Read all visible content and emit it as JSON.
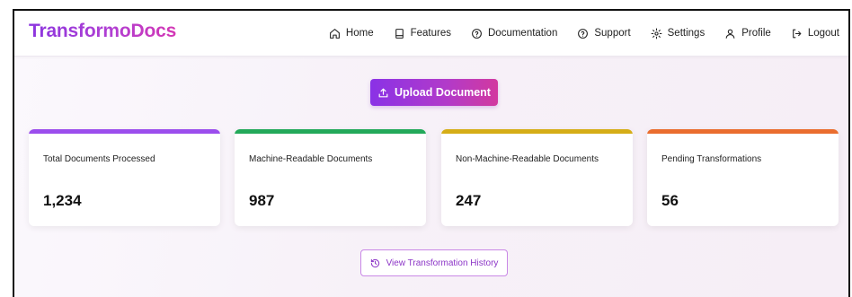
{
  "brand": "TransformoDocs",
  "nav": [
    {
      "label": "Home",
      "icon": "home-icon"
    },
    {
      "label": "Features",
      "icon": "document-icon"
    },
    {
      "label": "Documentation",
      "icon": "help-circle-icon"
    },
    {
      "label": "Support",
      "icon": "help-circle-icon"
    },
    {
      "label": "Settings",
      "icon": "gear-icon"
    },
    {
      "label": "Profile",
      "icon": "user-icon"
    },
    {
      "label": "Logout",
      "icon": "logout-icon"
    }
  ],
  "upload": {
    "label": "Upload Document",
    "icon": "upload-icon"
  },
  "stats": [
    {
      "label": "Total Documents Processed",
      "value": "1,234",
      "accent": "#9b4ded"
    },
    {
      "label": "Machine-Readable Documents",
      "value": "987",
      "accent": "#23a95a"
    },
    {
      "label": "Non-Machine-Readable Documents",
      "value": "247",
      "accent": "#d5ad17"
    },
    {
      "label": "Pending Transformations",
      "value": "56",
      "accent": "#ea6d2e"
    }
  ],
  "history": {
    "label": "View Transformation History",
    "icon": "history-icon"
  },
  "colors": {
    "brand_start": "#8b35df",
    "brand_end": "#d437b4",
    "button_gradient_end": "#d2399f"
  }
}
